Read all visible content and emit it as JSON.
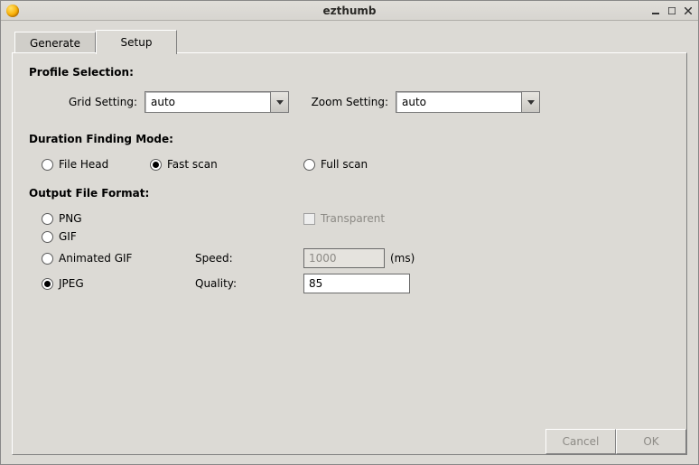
{
  "window": {
    "title": "ezthumb"
  },
  "tabs": {
    "generate": "Generate",
    "setup": "Setup"
  },
  "profile": {
    "heading": "Profile Selection:",
    "grid_label": "Grid Setting:",
    "grid_value": "auto",
    "zoom_label": "Zoom Setting:",
    "zoom_value": "auto"
  },
  "duration": {
    "heading": "Duration Finding Mode:",
    "file_head": "File Head",
    "fast_scan": "Fast scan",
    "full_scan": "Full scan"
  },
  "output": {
    "heading": "Output File Format:",
    "png": "PNG",
    "gif": "GIF",
    "animated_gif": "Animated GIF",
    "jpeg": "JPEG",
    "transparent": "Transparent",
    "speed_label": "Speed:",
    "speed_value": "1000",
    "speed_unit": "(ms)",
    "quality_label": "Quality:",
    "quality_value": "85"
  },
  "buttons": {
    "cancel": "Cancel",
    "ok": "OK"
  }
}
